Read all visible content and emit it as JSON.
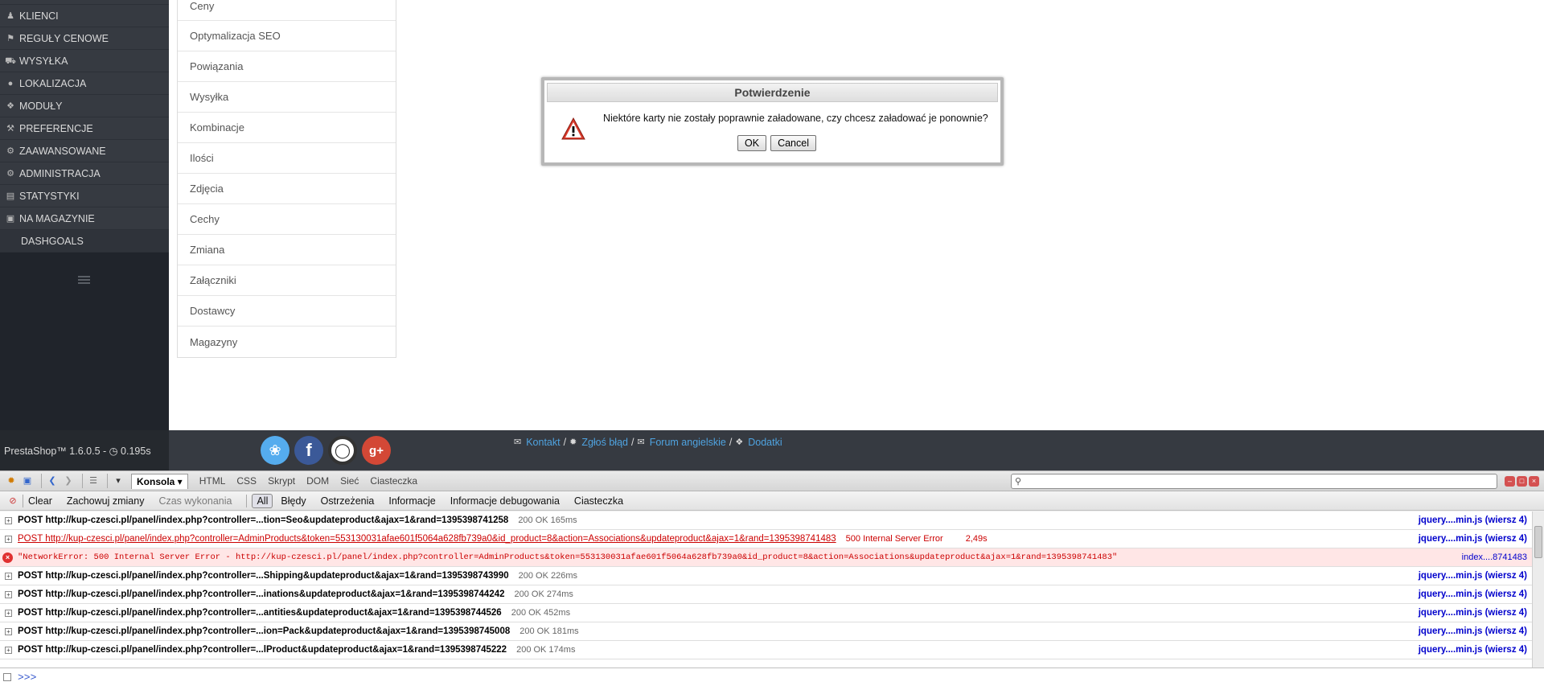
{
  "sidebar": {
    "items": [
      {
        "label": "KLIENCI",
        "icon": "users-icon"
      },
      {
        "label": "REGUŁY CENOWE",
        "icon": "tags-icon"
      },
      {
        "label": "WYSYŁKA",
        "icon": "truck-icon"
      },
      {
        "label": "LOKALIZACJA",
        "icon": "globe-icon"
      },
      {
        "label": "MODUŁY",
        "icon": "puzzle-icon"
      },
      {
        "label": "PREFERENCJE",
        "icon": "wrench-icon"
      },
      {
        "label": "ZAAWANSOWANE",
        "icon": "cogs-icon"
      },
      {
        "label": "ADMINISTRACJA",
        "icon": "cog-icon"
      },
      {
        "label": "STATYSTYKI",
        "icon": "bar-chart-icon"
      },
      {
        "label": "NA MAGAZYNIE",
        "icon": "archive-icon"
      }
    ],
    "sub_item": "DASHGOALS"
  },
  "product_tabs": [
    "Ceny",
    "Optymalizacja SEO",
    "Powiązania",
    "Wysyłka",
    "Kombinacje",
    "Ilości",
    "Zdjęcia",
    "Cechy",
    "Zmiana",
    "Załączniki",
    "Dostawcy",
    "Magazyny"
  ],
  "dialog": {
    "title": "Potwierdzenie",
    "message": "Niektóre karty nie zostały poprawnie załadowane, czy chcesz załadować je ponownie?",
    "ok": "OK",
    "cancel": "Cancel"
  },
  "footer": {
    "version": "PrestaShop™ 1.6.0.5 - ",
    "time": "0.195s",
    "links": {
      "contact": "Kontakt",
      "bug": "Zgłoś błąd",
      "forum": "Forum angielskie",
      "addons": "Dodatki"
    },
    "sep": "/"
  },
  "firebug": {
    "tabs": {
      "console": "Konsola",
      "html": "HTML",
      "css": "CSS",
      "script": "Skrypt",
      "dom": "DOM",
      "net": "Sieć",
      "cookies": "Ciasteczka"
    },
    "filters": {
      "clear": "Clear",
      "persist": "Zachowuj zmiany",
      "profile": "Czas wykonania",
      "all": "All",
      "errors": "Błędy",
      "warnings": "Ostrzeżenia",
      "info": "Informacje",
      "debug": "Informacje debugowania",
      "cookies": "Ciasteczka"
    },
    "log": [
      {
        "req": "POST http://kup-czesci.pl/panel/index.php?controller=...tion=Seo&updateproduct&ajax=1&rand=1395398741258",
        "status": "200 OK 165ms",
        "src": "jquery....min.js (wiersz 4)"
      },
      {
        "req": "POST http://kup-czesci.pl/panel/index.php?controller=AdminProducts&token=553130031afae601f5064a628fb739a0&id_product=8&action=Associations&updateproduct&ajax=1&rand=1395398741483",
        "status": "500 Internal Server Error",
        "time": "2,49s",
        "src": "jquery....min.js (wiersz 4)"
      },
      {
        "req": "\"NetworkError: 500 Internal Server Error - http://kup-czesci.pl/panel/index.php?controller=AdminProducts&token=553130031afae601f5064a628fb739a0&id_product=8&action=Associations&updateproduct&ajax=1&rand=1395398741483\"",
        "src": "index....8741483"
      },
      {
        "req": "POST http://kup-czesci.pl/panel/index.php?controller=...Shipping&updateproduct&ajax=1&rand=1395398743990",
        "status": "200 OK 226ms",
        "src": "jquery....min.js (wiersz 4)"
      },
      {
        "req": "POST http://kup-czesci.pl/panel/index.php?controller=...inations&updateproduct&ajax=1&rand=1395398744242",
        "status": "200 OK 274ms",
        "src": "jquery....min.js (wiersz 4)"
      },
      {
        "req": "POST http://kup-czesci.pl/panel/index.php?controller=...antities&updateproduct&ajax=1&rand=1395398744526",
        "status": "200 OK 452ms",
        "src": "jquery....min.js (wiersz 4)"
      },
      {
        "req": "POST http://kup-czesci.pl/panel/index.php?controller=...ion=Pack&updateproduct&ajax=1&rand=1395398745008",
        "status": "200 OK 181ms",
        "src": "jquery....min.js (wiersz 4)"
      },
      {
        "req": "POST http://kup-czesci.pl/panel/index.php?controller=...lProduct&updateproduct&ajax=1&rand=1395398745222",
        "status": "200 OK 174ms",
        "src": "jquery....min.js (wiersz 4)"
      }
    ],
    "prompt": ">>>"
  }
}
